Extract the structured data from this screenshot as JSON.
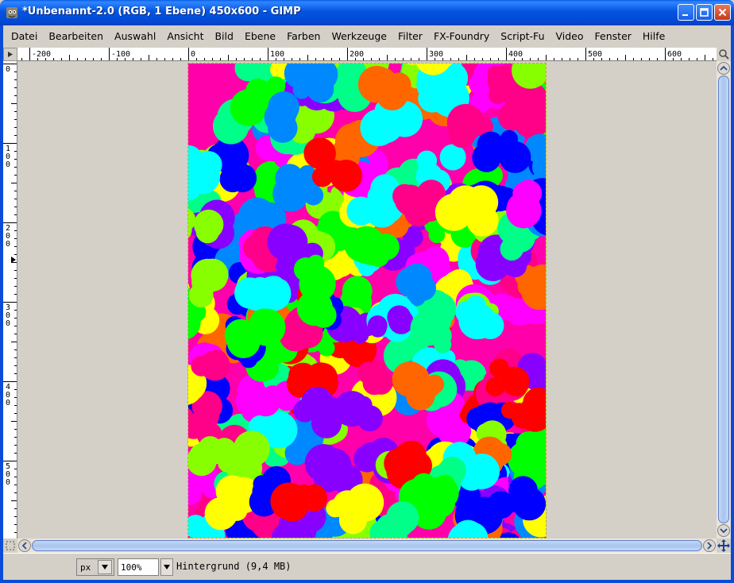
{
  "window": {
    "title": "*Unbenannt-2.0 (RGB, 1 Ebene) 450x600 - GIMP"
  },
  "menubar": {
    "items": [
      "Datei",
      "Bearbeiten",
      "Auswahl",
      "Ansicht",
      "Bild",
      "Ebene",
      "Farben",
      "Werkzeuge",
      "Filter",
      "FX-Foundry",
      "Script-Fu",
      "Video",
      "Fenster",
      "Hilfe"
    ]
  },
  "ruler": {
    "horizontal_labels": [
      "-200",
      "-100",
      "0",
      "100",
      "200",
      "300",
      "400",
      "500",
      "600"
    ],
    "vertical_labels": [
      "0",
      "100",
      "200",
      "300",
      "400",
      "500"
    ]
  },
  "statusbar": {
    "unit": "px",
    "zoom": "100%",
    "layer_info": "Hintergrund (9,4 MB)"
  },
  "icons": {
    "app": "gimp-wilber-icon",
    "minimize": "minimize-icon",
    "maximize": "maximize-icon",
    "close": "close-icon",
    "menu_arrow": "ruler-corner-menu-icon",
    "navigate": "navigate-cross-icon",
    "quick_mask": "quick-mask-icon"
  },
  "colors": {
    "titlebar": "#0454e0",
    "canvas_bg": "#d4d0c8",
    "palette": [
      "#ff0000",
      "#00ff00",
      "#0000ff",
      "#ffff00",
      "#ff00ff",
      "#00ffff",
      "#ff6600",
      "#8800ff",
      "#0088ff",
      "#ff0088",
      "#88ff00",
      "#00ff88"
    ]
  }
}
